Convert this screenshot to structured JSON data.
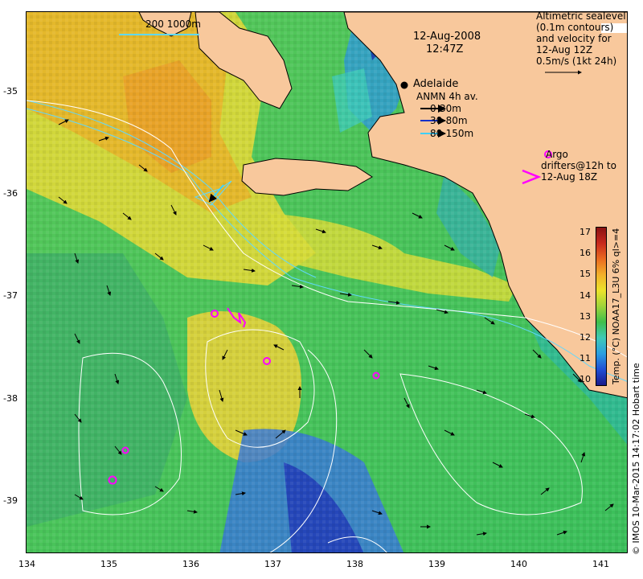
{
  "map": {
    "date": "12-Aug-2008",
    "time": "12:47Z",
    "scale_label": "200  1000m",
    "city_label": "Adelaide",
    "legend_altimetry": {
      "line1": "Altimetric sealevel",
      "line2": "(0.1m contours)",
      "line3": "and velocity for",
      "line4": "12-Aug 12Z",
      "line5": "0.5m/s (1kt 24h)"
    },
    "legend_anmn": {
      "title": "ANMN 4h av.",
      "item1": "0-30m",
      "item2": "30-80m",
      "item3": "80-150m",
      "colors": [
        "#000000",
        "#1432c8",
        "#3fd0ff"
      ]
    },
    "legend_argo": {
      "line1": "Argo",
      "line2": "drifters@12h to",
      "line3": "12-Aug 18Z",
      "color": "#ff00ff"
    },
    "colorbar": {
      "ticks": [
        "10",
        "11",
        "12",
        "13",
        "14",
        "15",
        "16",
        "17"
      ],
      "label": "Temp. (°C) NOAA17_L3U 6% ql>=4",
      "min": 10,
      "max": 17.5
    },
    "x_ticks": [
      "134",
      "135",
      "136",
      "137",
      "138",
      "139",
      "140",
      "141"
    ],
    "y_ticks": [
      "-35",
      "-36",
      "-37",
      "-38",
      "-39"
    ],
    "credit": "© IMOS 10-Mar-2015 14:17:02 Hobart time",
    "colors": {
      "land": "#f8c89c",
      "land_edge": "#000000",
      "contour": "#ffffff",
      "isobath": "#5fd8ff",
      "argo": "#ff00ff"
    }
  }
}
